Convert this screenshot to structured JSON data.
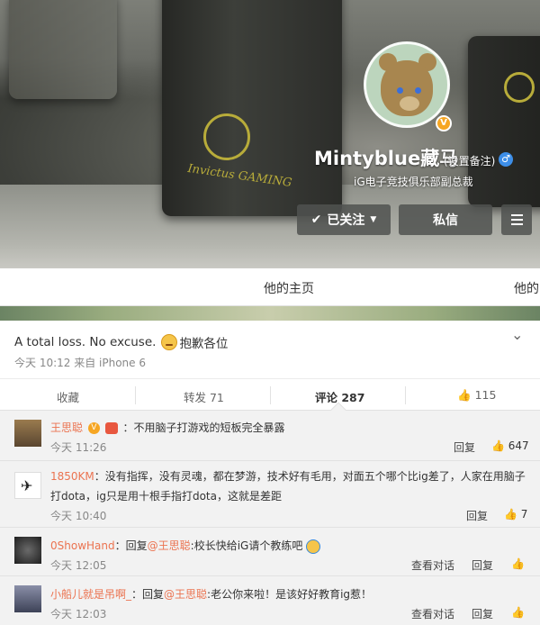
{
  "profile": {
    "nickname": "Mintyblue藏马",
    "remark": "(设置备注)",
    "bio": "iG电子竞技俱乐部副总裁",
    "gender_symbol": "♂",
    "verified_symbol": "V",
    "cover_logo_text": "Invictus GAMING",
    "buttons": {
      "follow": "已关注",
      "message": "私信"
    }
  },
  "tabs": {
    "home": "他的主页",
    "other": "他的"
  },
  "post": {
    "text_before_emoji": "A total loss. No excuse.",
    "text_after_emoji": "抱歉各位",
    "meta": "今天 10:12 来自 iPhone 6"
  },
  "actions": {
    "favorite": "收藏",
    "repost": "转发 71",
    "comment": "评论 287",
    "like": "115"
  },
  "comments": [
    {
      "user": "王思聪",
      "content": "：不用脑子打游戏的短板完全暴露",
      "time": "今天 11:26",
      "reply": "回复",
      "likes": "647"
    },
    {
      "user": "1850KM",
      "content": "：没有指挥，没有灵魂，都在梦游，技术好有毛用，对面五个哪个比ig差了，人家在用脑子",
      "content2": "打dota，ig只是用十根手指打dota，这就是差距",
      "time": "今天 10:40",
      "reply": "回复",
      "likes": "7"
    },
    {
      "user": "0ShowHand",
      "content_pre": "：回复",
      "mention": "@王思聪",
      "content": ":校长快给iG请个教练吧",
      "time": "今天 12:05",
      "conversation": "查看对话",
      "reply": "回复"
    },
    {
      "user": "小船儿就是吊啊_",
      "content_pre": "：回复",
      "mention": "@王思聪",
      "content": ":老公你来啦！是该好好教育ig惹！",
      "time": "今天 12:03",
      "conversation": "查看对话",
      "reply": "回复"
    }
  ]
}
